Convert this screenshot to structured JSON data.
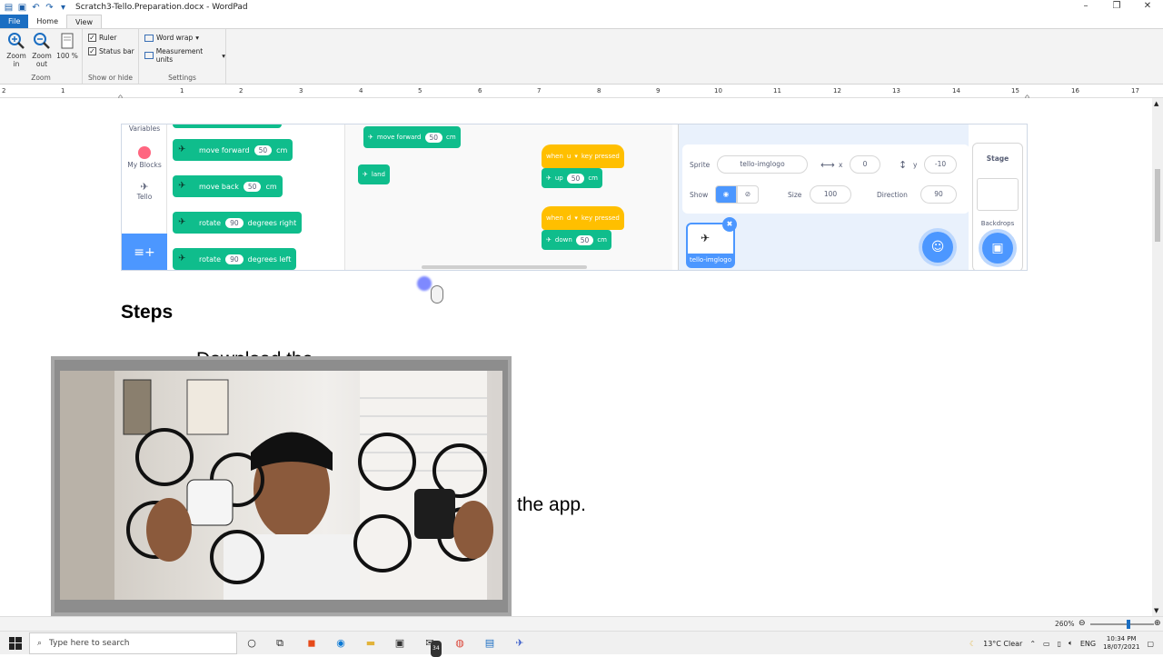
{
  "window": {
    "title": "Scratch3-Tello.Preparation.docx - WordPad"
  },
  "tabs": {
    "file": "File",
    "home": "Home",
    "view": "View"
  },
  "ribbon": {
    "zoom": {
      "zoom_in": "Zoom in",
      "zoom_out": "Zoom out",
      "hundred": "100 %",
      "group_label": "Zoom"
    },
    "show_hide": {
      "ruler": "Ruler",
      "status_bar": "Status bar",
      "group_label": "Show or hide"
    },
    "settings": {
      "word_wrap": "Word wrap",
      "measurement_units": "Measurement units",
      "group_label": "Settings"
    }
  },
  "ruler": {
    "ticks": [
      "2",
      "1",
      "1",
      "2",
      "3",
      "4",
      "5",
      "6",
      "7",
      "8",
      "9",
      "10",
      "11",
      "12",
      "13",
      "14",
      "15",
      "16",
      "17"
    ]
  },
  "scratch": {
    "categories": [
      "Variables",
      "My Blocks",
      "Tello"
    ],
    "palette_blocks": [
      {
        "label": "move forward",
        "value": "50",
        "unit": "cm"
      },
      {
        "label": "move back",
        "value": "50",
        "unit": "cm"
      },
      {
        "label": "rotate",
        "value": "90",
        "unit": "degrees right"
      },
      {
        "label": "rotate",
        "value": "90",
        "unit": "degrees left"
      }
    ],
    "code": {
      "move_forward": "move forward",
      "move_forward_val": "50",
      "move_forward_unit": "cm",
      "land": "land",
      "when1": "when",
      "key1": "u",
      "pressed1": "key pressed",
      "up": "up",
      "up_val": "50",
      "up_unit": "cm",
      "when2": "when",
      "key2": "d",
      "pressed2": "key pressed",
      "down": "down",
      "down_val": "50",
      "down_unit": "cm"
    },
    "sprite": {
      "sprite_label": "Sprite",
      "sprite_name": "tello-imglogo",
      "x_label": "x",
      "x": "0",
      "y_label": "y",
      "y": "-10",
      "show_label": "Show",
      "size_label": "Size",
      "size": "100",
      "direction_label": "Direction",
      "direction": "90",
      "thumb_label": "tello-imglogo"
    },
    "stage": {
      "label": "Stage",
      "backdrops": "Backdrops"
    }
  },
  "doc": {
    "steps_heading": "Steps",
    "partial_text": "Download the",
    "the_app": "the app."
  },
  "status": {
    "zoom": "260%"
  },
  "taskbar": {
    "search_placeholder": "Type here to search",
    "mail_badge": "34",
    "weather": "13°C  Clear",
    "lang": "ENG",
    "time": "10:34 PM",
    "date": "18/07/2021"
  }
}
